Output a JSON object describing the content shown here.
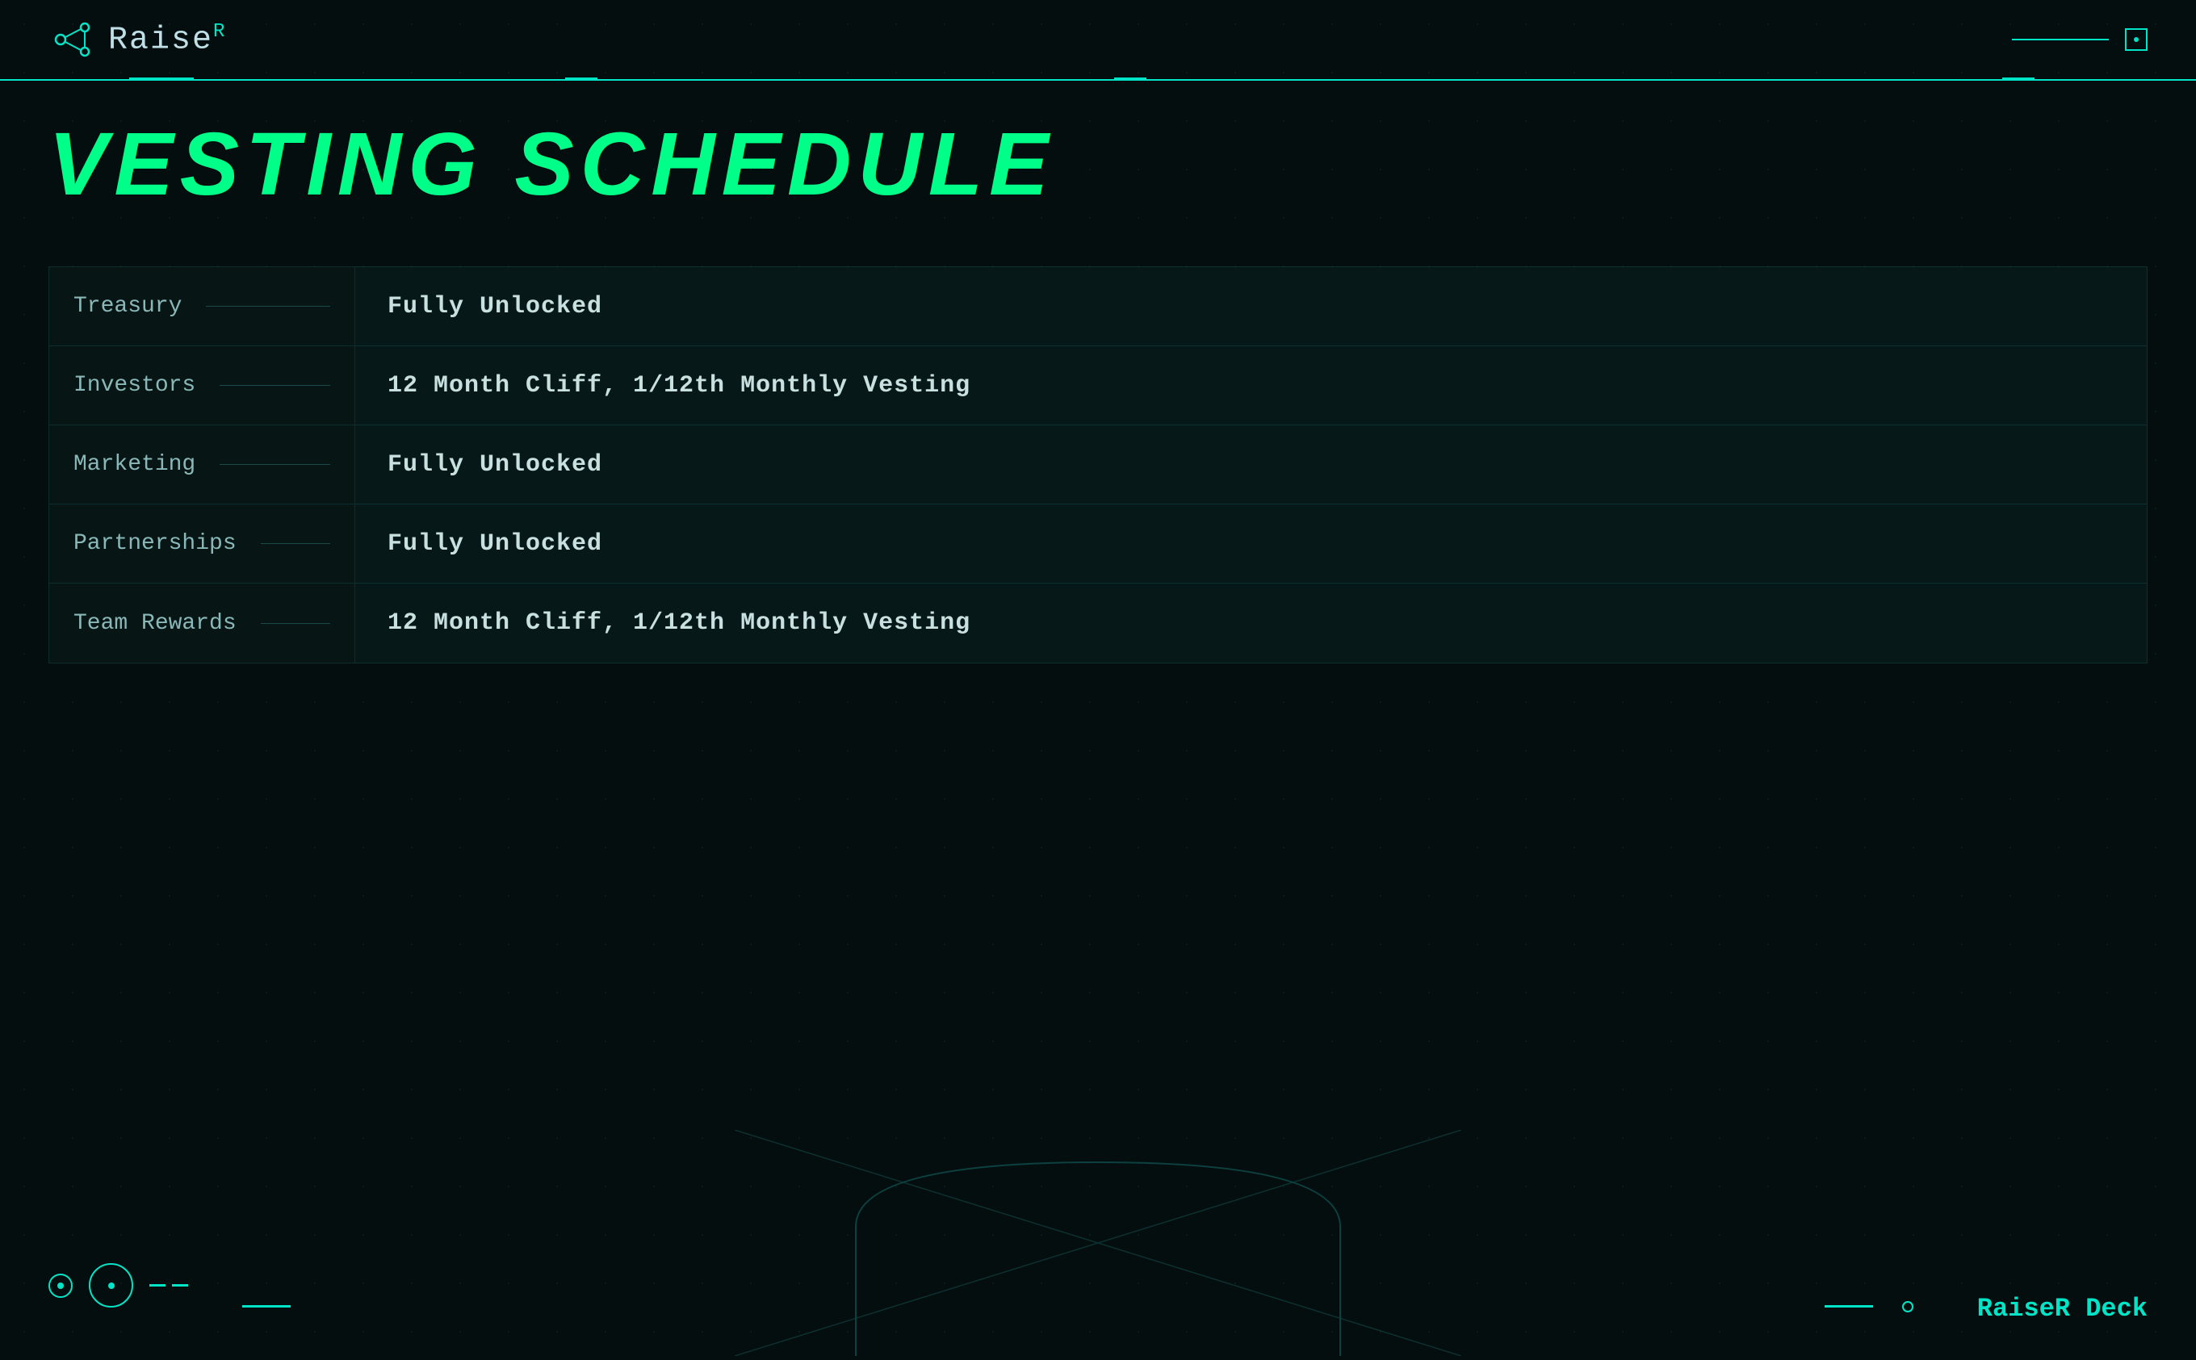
{
  "header": {
    "logo_text": "Raise",
    "logo_superscript": "R",
    "brand_color": "#00e5c8"
  },
  "page": {
    "title": "VESTING SCHEDULE"
  },
  "table": {
    "rows": [
      {
        "label": "Treasury",
        "value": "Fully Unlocked"
      },
      {
        "label": "Investors",
        "value": "12 Month Cliff, 1/12th Monthly Vesting"
      },
      {
        "label": "Marketing",
        "value": "Fully Unlocked"
      },
      {
        "label": "Partnerships",
        "value": "Fully Unlocked"
      },
      {
        "label": "Team Rewards",
        "value": "12 Month Cliff, 1/12th Monthly Vesting"
      }
    ]
  },
  "footer": {
    "brand_label": "RaiseR Deck"
  }
}
